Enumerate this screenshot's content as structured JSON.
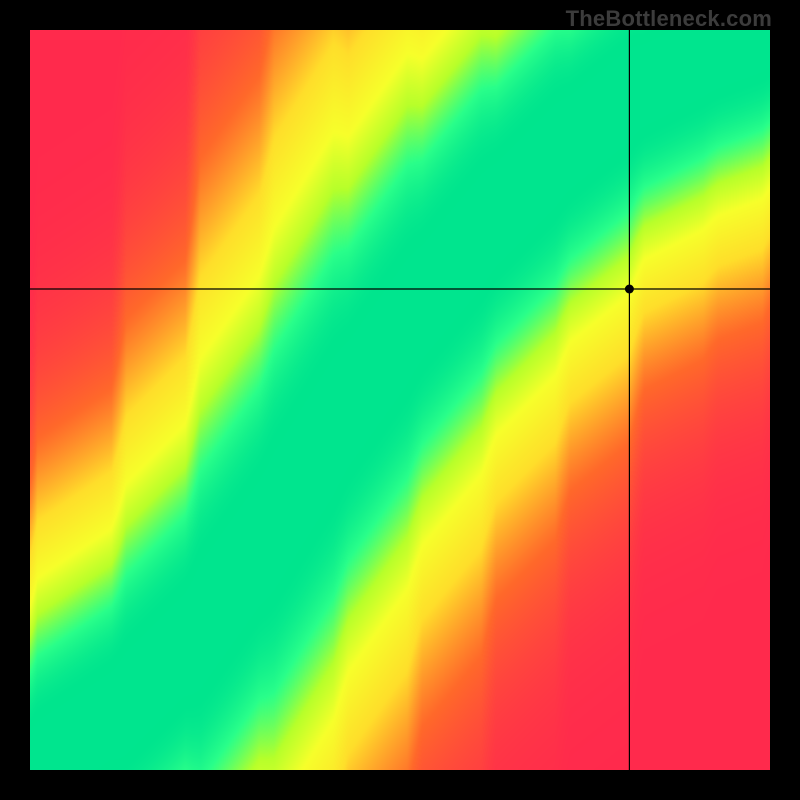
{
  "watermark": "TheBottleneck.com",
  "chart_data": {
    "type": "heatmap",
    "title": "",
    "xlabel": "",
    "ylabel": "",
    "xlim": [
      0,
      100
    ],
    "ylim": [
      0,
      100
    ],
    "legend": null,
    "grid": false,
    "colormap": {
      "stops": [
        {
          "t": 0.0,
          "color": "#ff2a4d"
        },
        {
          "t": 0.25,
          "color": "#ff6a2a"
        },
        {
          "t": 0.5,
          "color": "#ffdf2a"
        },
        {
          "t": 0.7,
          "color": "#f7ff2a"
        },
        {
          "t": 0.82,
          "color": "#b8ff2a"
        },
        {
          "t": 0.93,
          "color": "#2aff8a"
        },
        {
          "t": 1.0,
          "color": "#00e58e"
        }
      ]
    },
    "ideal_curve_points": [
      {
        "x": 0,
        "y": 0
      },
      {
        "x": 12,
        "y": 8
      },
      {
        "x": 22,
        "y": 18
      },
      {
        "x": 32,
        "y": 32
      },
      {
        "x": 42,
        "y": 48
      },
      {
        "x": 52,
        "y": 62
      },
      {
        "x": 62,
        "y": 74
      },
      {
        "x": 72,
        "y": 84
      },
      {
        "x": 82,
        "y": 92
      },
      {
        "x": 92,
        "y": 97
      },
      {
        "x": 100,
        "y": 100
      }
    ],
    "band_halfwidth": 5.0,
    "falloff": 38.0,
    "crosshair": {
      "x": 81,
      "y": 65
    }
  }
}
